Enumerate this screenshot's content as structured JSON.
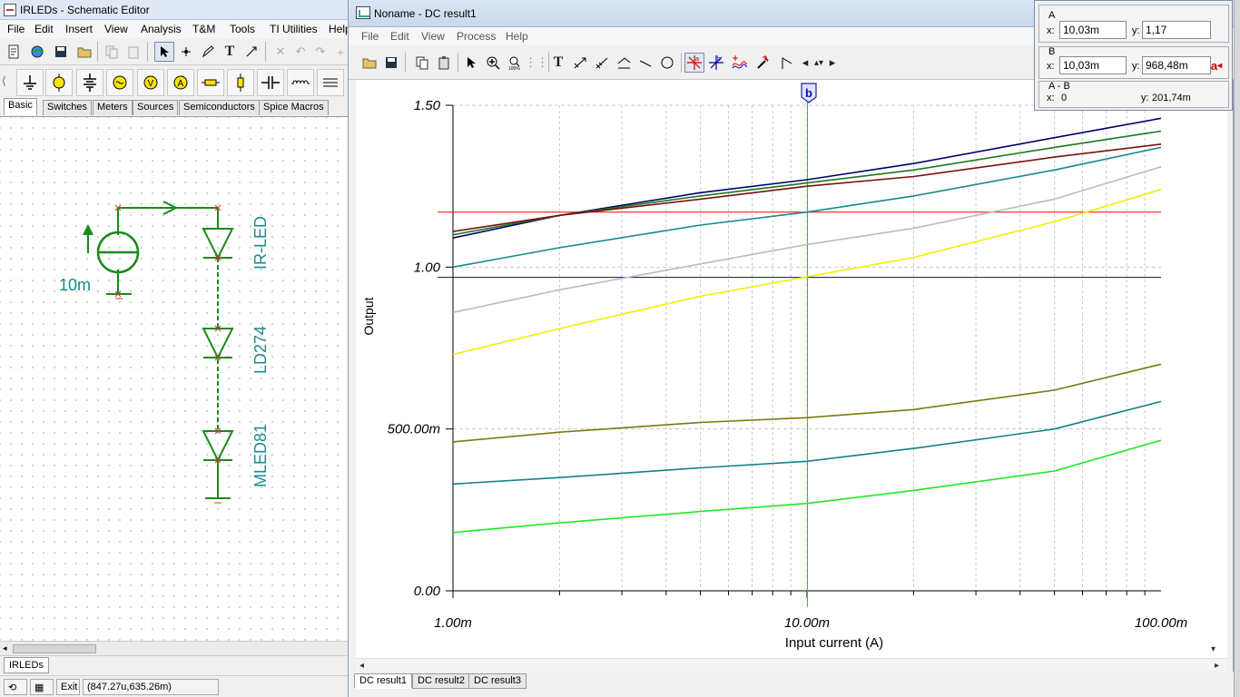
{
  "schematic": {
    "title": "IRLEDs - Schematic Editor",
    "menu": [
      "File",
      "Edit",
      "Insert",
      "View",
      "Analysis",
      "T&M",
      "Tools",
      "TI Utilities",
      "Help"
    ],
    "component_tabs": [
      "Basic",
      "Switches",
      "Meters",
      "Sources",
      "Semiconductors",
      "Spice Macros"
    ],
    "active_tab": "Basic",
    "source_label": "10m",
    "diode_labels": [
      "IR-LED",
      "LD274",
      "MLED81"
    ],
    "page_tab": "IRLEDs",
    "status": {
      "exit_label": "Exit",
      "coords": "(847.27u,635.26m)"
    }
  },
  "result_window": {
    "title": "Noname - DC result1",
    "menu": [
      "File",
      "Edit",
      "View",
      "Process",
      "Help"
    ],
    "tabs": [
      "DC result1",
      "DC result2",
      "DC result3"
    ],
    "active_tab": "DC result1",
    "cursor_marker": "b"
  },
  "cursor_panel": {
    "a": {
      "header": "A",
      "x_label": "x:",
      "x_value": "10,03m",
      "y_label": "y:",
      "y_value": "1,17"
    },
    "b": {
      "header": "B",
      "x_label": "x:",
      "x_value": "10,03m",
      "y_label": "y:",
      "y_value": "968,48m"
    },
    "ab": {
      "header": "A - B",
      "x_label": "x:",
      "x_value": "0",
      "y_label": "y:",
      "y_value": "201,74m"
    },
    "a_button": "a"
  },
  "chart_data": {
    "type": "line",
    "xlabel": "Input current (A)",
    "ylabel": "Output",
    "x_scale": "log",
    "xlim": [
      0.001,
      0.1
    ],
    "ylim": [
      0,
      1.5
    ],
    "x_tick_labels": [
      "1.00m",
      "10.00m",
      "100.00m"
    ],
    "y_tick_labels": [
      "0.00",
      "500.00m",
      "1.00",
      "1.50"
    ],
    "grid": true,
    "x": [
      0.001,
      0.002,
      0.005,
      0.01,
      0.02,
      0.05,
      0.1
    ],
    "series": [
      {
        "color": "#00006e",
        "values": [
          1.09,
          1.16,
          1.23,
          1.27,
          1.32,
          1.4,
          1.46
        ]
      },
      {
        "color": "#1a7a1a",
        "values": [
          1.1,
          1.16,
          1.22,
          1.26,
          1.3,
          1.37,
          1.42
        ]
      },
      {
        "color": "#7a1010",
        "values": [
          1.11,
          1.16,
          1.21,
          1.25,
          1.28,
          1.34,
          1.38
        ]
      },
      {
        "color": "#198a8a",
        "values": [
          1.0,
          1.06,
          1.13,
          1.17,
          1.22,
          1.3,
          1.37
        ]
      },
      {
        "color": "#bbbbbb",
        "values": [
          0.86,
          0.93,
          1.01,
          1.07,
          1.12,
          1.21,
          1.31
        ]
      },
      {
        "color": "#f0f000",
        "values": [
          0.73,
          0.81,
          0.91,
          0.97,
          1.03,
          1.14,
          1.24
        ]
      },
      {
        "color": "#7a7a12",
        "values": [
          0.46,
          0.49,
          0.52,
          0.535,
          0.56,
          0.62,
          0.7
        ]
      },
      {
        "color": "#13808a",
        "values": [
          0.33,
          0.35,
          0.38,
          0.4,
          0.44,
          0.5,
          0.585
        ]
      },
      {
        "color": "#22e822",
        "values": [
          0.18,
          0.21,
          0.245,
          0.27,
          0.31,
          0.37,
          0.465
        ]
      }
    ],
    "cursor_lines": {
      "vertical_x": 0.01003,
      "horizontal_a_y": 1.17,
      "horizontal_b_y": 0.96848,
      "vertical_color": "#22cc22",
      "a_color": "#ff0000",
      "b_color": "#0000aa"
    }
  }
}
